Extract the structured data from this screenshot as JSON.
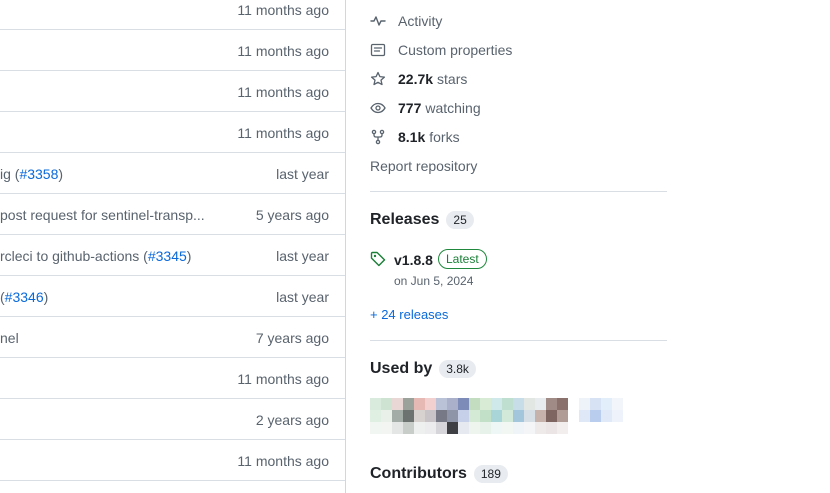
{
  "file_rows": [
    {
      "message": "",
      "pr": "",
      "age": "11 months ago"
    },
    {
      "message": "",
      "pr": "",
      "age": "11 months ago"
    },
    {
      "message": "",
      "pr": "",
      "age": "11 months ago"
    },
    {
      "message": "",
      "pr": "",
      "age": "11 months ago"
    },
    {
      "message": "ig (",
      "pr": "#3358",
      "suffix": ")",
      "age": "last year"
    },
    {
      "message": " post request for sentinel-transp...",
      "pr": "",
      "age": "5 years ago"
    },
    {
      "message": "rcleci to github-actions (",
      "pr": "#3345",
      "suffix": ")",
      "age": "last year"
    },
    {
      "message": "(",
      "pr": "#3346",
      "suffix": ")",
      "age": "last year"
    },
    {
      "message": "nel",
      "pr": "",
      "age": "7 years ago"
    },
    {
      "message": "",
      "pr": "",
      "age": "11 months ago"
    },
    {
      "message": "",
      "pr": "",
      "age": "2 years ago"
    },
    {
      "message": "",
      "pr": "",
      "age": "11 months ago"
    }
  ],
  "about": {
    "activity": "Activity",
    "custom_properties": "Custom properties",
    "stars_count": "22.7k",
    "stars_label": "stars",
    "watching_count": "777",
    "watching_label": "watching",
    "forks_count": "8.1k",
    "forks_label": "forks",
    "report": "Report repository"
  },
  "releases": {
    "title": "Releases",
    "count": "25",
    "latest_version": "v1.8.8",
    "latest_badge": "Latest",
    "latest_date": "on Jun 5, 2024",
    "more_link": "+ 24 releases"
  },
  "used_by": {
    "title": "Used by",
    "count": "3.8k"
  },
  "contributors": {
    "title": "Contributors",
    "count": "189"
  },
  "colors": {
    "link": "#0969da",
    "muted": "#59636e",
    "latest_green": "#1a7f37"
  }
}
